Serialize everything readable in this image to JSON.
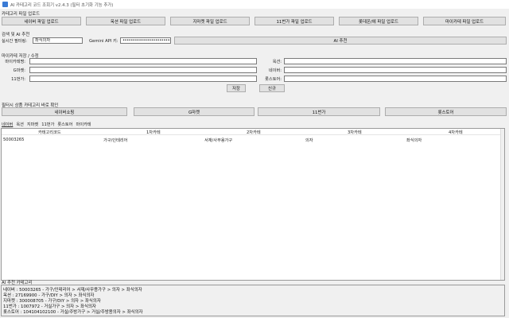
{
  "window": {
    "title": "AI 카테고리 코드 조회기 v2.4.3 (필터 초기화 기능 추가)"
  },
  "upload": {
    "section_label": "카테고리 파일 업로드",
    "buttons": [
      "네이버 파일 업로드",
      "옥션 파일 업로드",
      "지마켓 파일 업로드",
      "11번가 파일 업로드",
      "롯데온/에 파일 업로드",
      "마이카테 파일 업로드"
    ]
  },
  "search": {
    "section_label": "검색 및 AI 추천",
    "realtime_label": "실시간 필터링:",
    "realtime_value": "좌식의자",
    "gemini_label": "Gemini API 키:",
    "gemini_value": "••••••••••••••••••••••••••••••",
    "ai_button": "AI 추천"
  },
  "mycategory": {
    "section_label": "마이카테 저장 / 수정",
    "left_fields": [
      "마이카테명:",
      "G마켓:",
      "11번가:"
    ],
    "right_fields": [
      "옥션:",
      "네이버:",
      "롯스토어:"
    ],
    "save_button": "저장",
    "new_button": "신규"
  },
  "mall_check": {
    "section_label": "필터시 상품 카테고리 바로 확인",
    "buttons": [
      "네이버쇼핑",
      "G마켓",
      "11번가",
      "롯스토어"
    ]
  },
  "tabs": [
    "네이버",
    "옥션",
    "지마켓",
    "11번가",
    "롯스토어",
    "마이카테"
  ],
  "table": {
    "headers": [
      "카테고리코드",
      "1차카테",
      "2차카테",
      "3차카테",
      "4차카테"
    ],
    "rows": [
      [
        "50003265",
        "가구/인테리어",
        "서재/사무용가구",
        "의자",
        "좌식의자"
      ]
    ]
  },
  "ai_result": {
    "section_label": "AI 추천 카테고리",
    "lines": [
      "네이버 : 50003265 - 가구/인테리어 > 서재/사무용가구 > 의자 > 좌식의자",
      "옥션 : 27169900 - 가구/DIY > 의자 > 좌식의자",
      "지마켓 : 300008705 - 가구/DIY > 의자 > 좌식의자",
      "11번가 : 1007972 - 거실가구 > 의자 > 좌식의자",
      "롯스토어 : 104104102100 - 거실/주방가구 > 거실/주방용의자 > 좌식의자"
    ]
  }
}
